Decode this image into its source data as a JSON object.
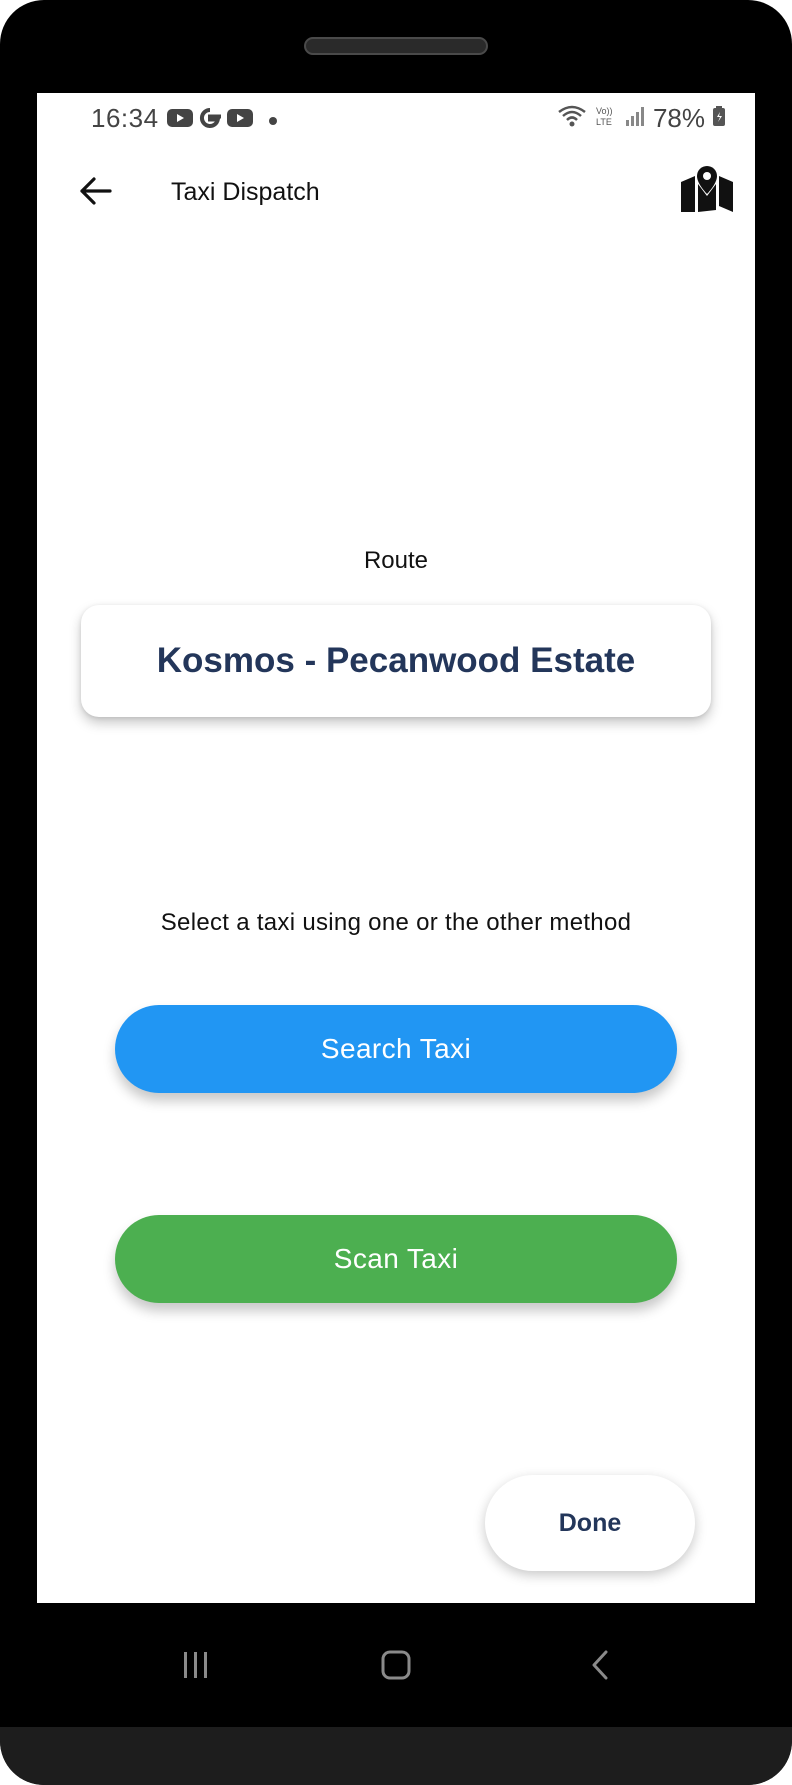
{
  "status_bar": {
    "time": "16:34",
    "battery": "78%",
    "left_icons": [
      "youtube-icon",
      "google-icon",
      "youtube-icon",
      "dot-icon"
    ],
    "right_icons": [
      "wifi-icon",
      "volte-icon",
      "signal-icon",
      "battery-icon"
    ]
  },
  "app_bar": {
    "title": "Taxi Dispatch",
    "back_icon": "arrow-left-icon",
    "action_icon": "map-icon"
  },
  "route": {
    "label": "Route",
    "name": "Kosmos - Pecanwood Estate"
  },
  "instruction": "Select a taxi using one or the other method",
  "buttons": {
    "search_label": "Search Taxi",
    "scan_label": "Scan Taxi",
    "done_label": "Done"
  },
  "colors": {
    "search_button": "#2196f3",
    "scan_button": "#4caf50",
    "route_text": "#23365a"
  },
  "nav_bar": {
    "icons": [
      "recents-icon",
      "home-icon",
      "back-icon"
    ]
  }
}
